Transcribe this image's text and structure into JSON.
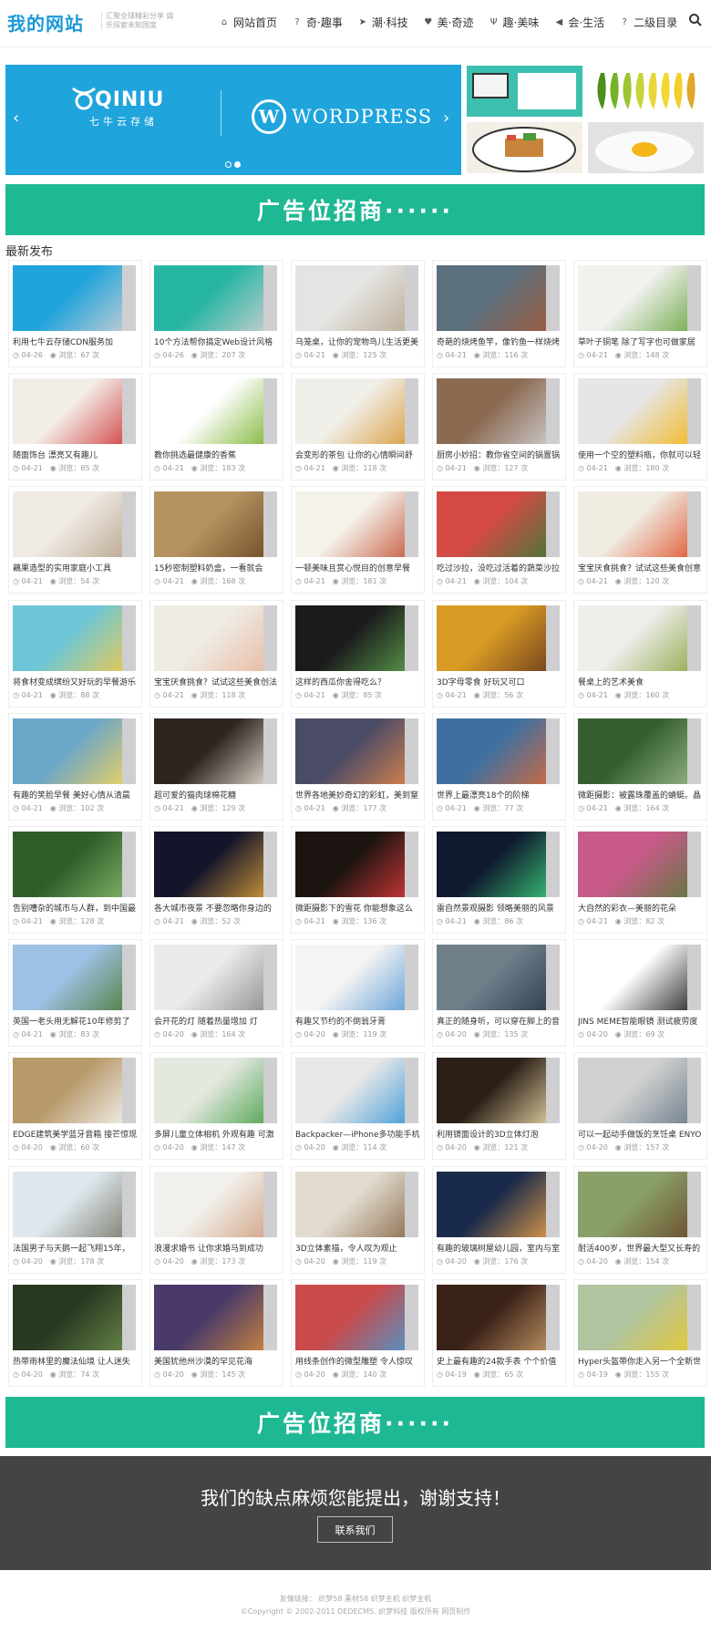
{
  "header": {
    "logo": "我的网站",
    "slogan": "汇聚全球精彩分享 娱乐探索未知国度",
    "nav": [
      {
        "label": "网站首页",
        "icon": "home-icon"
      },
      {
        "label": "奇·趣事",
        "icon": "question-circle-icon"
      },
      {
        "label": "潮·科技",
        "icon": "paper-plane-icon"
      },
      {
        "label": "美·奇迹",
        "icon": "heart-icon"
      },
      {
        "label": "趣·美味",
        "icon": "cutlery-icon"
      },
      {
        "label": "会·生活",
        "icon": "bullhorn-icon"
      },
      {
        "label": "二级目录",
        "icon": "question-circle-icon"
      }
    ]
  },
  "banner": {
    "brand1": "QINIU",
    "brand1_sub": "七牛云存储",
    "brand2": "WORDPRESS"
  },
  "ads": {
    "label": "广告位招商······"
  },
  "section": {
    "title": "最新发布"
  },
  "views_prefix": "浏览：",
  "views_suffix": " 次",
  "posts": [
    {
      "title": "利用七牛云存储CDN服务加",
      "date": "04-26",
      "views": "67",
      "c1": "#1fa4dc",
      "c2": "#cfcfd1"
    },
    {
      "title": "10个方法帮你搞定Web设计风格",
      "date": "04-26",
      "views": "207",
      "c1": "#27b6a4",
      "c2": "#cfcfd1"
    },
    {
      "title": "乌笼桌，让你的宠物鸟儿生活更美",
      "date": "04-21",
      "views": "125",
      "c1": "#e4e4e2",
      "c2": "#b9a891"
    },
    {
      "title": "奇葩的烧烤鱼竿，像钓鱼一样烧烤",
      "date": "04-21",
      "views": "116",
      "c1": "#5b6f7c",
      "c2": "#a55b3b"
    },
    {
      "title": "草叶子铜笔 除了写字也可做家居",
      "date": "04-21",
      "views": "148",
      "c1": "#f1f1ee",
      "c2": "#6aa743"
    },
    {
      "title": "随面饰台 漂亮又有趣儿",
      "date": "04-21",
      "views": "85",
      "c1": "#f3ede7",
      "c2": "#cf3c3c"
    },
    {
      "title": "教你挑选最健康的香蕉",
      "date": "04-21",
      "views": "183",
      "c1": "#ffffff",
      "c2": "#7ab32e"
    },
    {
      "title": "会变形的茶包 让你的心情瞬间舒",
      "date": "04-21",
      "views": "118",
      "c1": "#f1efe9",
      "c2": "#d89a38"
    },
    {
      "title": "厨房小妙招：教你省空间的锅置锅",
      "date": "04-21",
      "views": "127",
      "c1": "#8b6a52",
      "c2": "#cfcfd1"
    },
    {
      "title": "使用一个空的塑料瓶，你就可以轻",
      "date": "04-21",
      "views": "180",
      "c1": "#e6e6e6",
      "c2": "#f4b618"
    },
    {
      "title": "藕果造型的实用家庭小工具",
      "date": "04-21",
      "views": "54",
      "c1": "#efeae4",
      "c2": "#b8a48c"
    },
    {
      "title": "15秒密制塑料奶盒，一看就会",
      "date": "04-21",
      "views": "168",
      "c1": "#b5925f",
      "c2": "#6d4a25"
    },
    {
      "title": "一顿美味且赏心悦目的创意早餐",
      "date": "04-21",
      "views": "181",
      "c1": "#f5f2ea",
      "c2": "#c5553b"
    },
    {
      "title": "吃过沙拉，没吃过活着的蔬菜沙拉",
      "date": "04-21",
      "views": "104",
      "c1": "#d44a45",
      "c2": "#3d7b3a"
    },
    {
      "title": "宝宝厌食挑食？试试这些美食创意",
      "date": "04-21",
      "views": "120",
      "c1": "#f0ece2",
      "c2": "#e0532e"
    },
    {
      "title": "将食材变成缤纷又好玩的早餐游乐",
      "date": "04-21",
      "views": "88",
      "c1": "#6cc6d8",
      "c2": "#f2c94b"
    },
    {
      "title": "宝宝厌食挑食？试试这些美食创法",
      "date": "04-21",
      "views": "118",
      "c1": "#efece4",
      "c2": "#e8b7a0"
    },
    {
      "title": "这样的西瓜你舍得吃么？",
      "date": "04-21",
      "views": "85",
      "c1": "#1b1b1b",
      "c2": "#5b9e4c"
    },
    {
      "title": "3D字母零食 好玩又可口",
      "date": "04-21",
      "views": "56",
      "c1": "#d89a25",
      "c2": "#6b3b1c"
    },
    {
      "title": "餐桌上的艺术美食",
      "date": "04-21",
      "views": "160",
      "c1": "#eeeeea",
      "c2": "#8fa84a"
    },
    {
      "title": "有趣的笑脸早餐 美好心情从清晨",
      "date": "04-21",
      "views": "102",
      "c1": "#6aa6c8",
      "c2": "#f4d35e"
    },
    {
      "title": "超可爱的猫肉球棉花糖",
      "date": "04-21",
      "views": "129",
      "c1": "#2e2420",
      "c2": "#e9e0d4"
    },
    {
      "title": "世界各地美妙奇幻的彩虹，美到窒",
      "date": "04-21",
      "views": "177",
      "c1": "#4a4b66",
      "c2": "#e0864a"
    },
    {
      "title": "世界上最漂亮18个的阶梯",
      "date": "04-21",
      "views": "77",
      "c1": "#3f6fa0",
      "c2": "#d96b3a"
    },
    {
      "title": "微距摄影：被露珠覆盖的蜻蜓。晶",
      "date": "04-21",
      "views": "164",
      "c1": "#355f2f",
      "c2": "#9ab88c"
    },
    {
      "title": "告别嘈杂的城市与人群，到中国最",
      "date": "04-21",
      "views": "128",
      "c1": "#2e5e2a",
      "c2": "#86b56a"
    },
    {
      "title": "各大城市夜景 不要忽略你身边的",
      "date": "04-21",
      "views": "52",
      "c1": "#14142a",
      "c2": "#d9a03a"
    },
    {
      "title": "微距摄影下的雪花 你能想象这么",
      "date": "04-21",
      "views": "136",
      "c1": "#1c1410",
      "c2": "#d93a3a"
    },
    {
      "title": "雷自然景观摄影 领略美丽的风景",
      "date": "04-21",
      "views": "86",
      "c1": "#0f1a2e",
      "c2": "#3bc97a"
    },
    {
      "title": "大自然的彩衣—美丽的花朵",
      "date": "04-21",
      "views": "82",
      "c1": "#c85a8a",
      "c2": "#5a7a3a"
    },
    {
      "title": "英国一老头用无解花10年修剪了",
      "date": "04-21",
      "views": "83",
      "c1": "#9ec2e6",
      "c2": "#4f7a36"
    },
    {
      "title": "会开花的灯 随着热量增加 灯",
      "date": "04-20",
      "views": "164",
      "c1": "#eaeaea",
      "c2": "#8a8a8a"
    },
    {
      "title": "有趣又节约的不倒翁牙膏",
      "date": "04-20",
      "views": "119",
      "c1": "#f4f4f4",
      "c2": "#5a9ad6"
    },
    {
      "title": "真正的随身听，可以穿在脚上的音",
      "date": "04-20",
      "views": "135",
      "c1": "#6f7f8a",
      "c2": "#2b3a4a"
    },
    {
      "title": "JINS MEME智能眼镜 测试疲劳度",
      "date": "04-20",
      "views": "69",
      "c1": "#ffffff",
      "c2": "#222222"
    },
    {
      "title": "EDGE建筑美学蓝牙音箱 接芒惊现",
      "date": "04-20",
      "views": "60",
      "c1": "#b79a6a",
      "c2": "#f4f4f4"
    },
    {
      "title": "多屏儿童立体相机 外观有趣 可激",
      "date": "04-20",
      "views": "147",
      "c1": "#e4e9e0",
      "c2": "#4aa04a"
    },
    {
      "title": "Backpacker—iPhone多功能手机",
      "date": "04-20",
      "views": "114",
      "c1": "#e8e8e8",
      "c2": "#3a98d8"
    },
    {
      "title": "利用镜面设计的3D立体灯泡",
      "date": "04-20",
      "views": "121",
      "c1": "#2a1e16",
      "c2": "#e8d7a8"
    },
    {
      "title": "可以一起动手做饭的烹饪桌 ENYO",
      "date": "04-20",
      "views": "157",
      "c1": "#cfd0cf",
      "c2": "#6a7a8a"
    },
    {
      "title": "法国男子与天鹅一起飞翔15年，",
      "date": "04-20",
      "views": "178",
      "c1": "#dfe8ee",
      "c2": "#7a7a6a"
    },
    {
      "title": "浪漫求婚书 让你求婚马到成功",
      "date": "04-20",
      "views": "173",
      "c1": "#f2f0ec",
      "c2": "#d0a080"
    },
    {
      "title": "3D立体素描，令人叹为观止",
      "date": "04-20",
      "views": "119",
      "c1": "#e2dcd0",
      "c2": "#8a6a4a"
    },
    {
      "title": "有趣的玻璃树屋幼儿园，室内与室",
      "date": "04-20",
      "views": "176",
      "c1": "#1a2a4a",
      "c2": "#e8a04a"
    },
    {
      "title": "耐活400岁，世界最大型又长寿的",
      "date": "04-20",
      "views": "154",
      "c1": "#8aa06a",
      "c2": "#6a4a2a"
    },
    {
      "title": "热带雨林里的魔法仙境 让人迷失",
      "date": "04-20",
      "views": "74",
      "c1": "#2a3a22",
      "c2": "#6a8a4a"
    },
    {
      "title": "美国犹他州沙漠的罕见花海",
      "date": "04-20",
      "views": "145",
      "c1": "#4a3a6a",
      "c2": "#d48a3a"
    },
    {
      "title": "用线条创作的微型雕塑 令人惊叹",
      "date": "04-20",
      "views": "140",
      "c1": "#c84a4a",
      "c2": "#4a9ad0"
    },
    {
      "title": "史上最有趣的24款手表 个个价值",
      "date": "04-19",
      "views": "65",
      "c1": "#3a2218",
      "c2": "#c89a6a"
    },
    {
      "title": "Hyper头盔带你走入另一个全新世",
      "date": "04-19",
      "views": "155",
      "c1": "#b0c4a0",
      "c2": "#e8c830"
    }
  ],
  "cta": {
    "text": "我们的缺点麻烦您能提出，谢谢支持！",
    "button": "联系我们"
  },
  "footer": {
    "links_label": "友情链接：",
    "links": "织梦58 素材58 织梦主机 织梦主机",
    "copyright": "©Copyright © 2002-2011 DEDECMS. 织梦科技 版权所有  网页制作"
  }
}
